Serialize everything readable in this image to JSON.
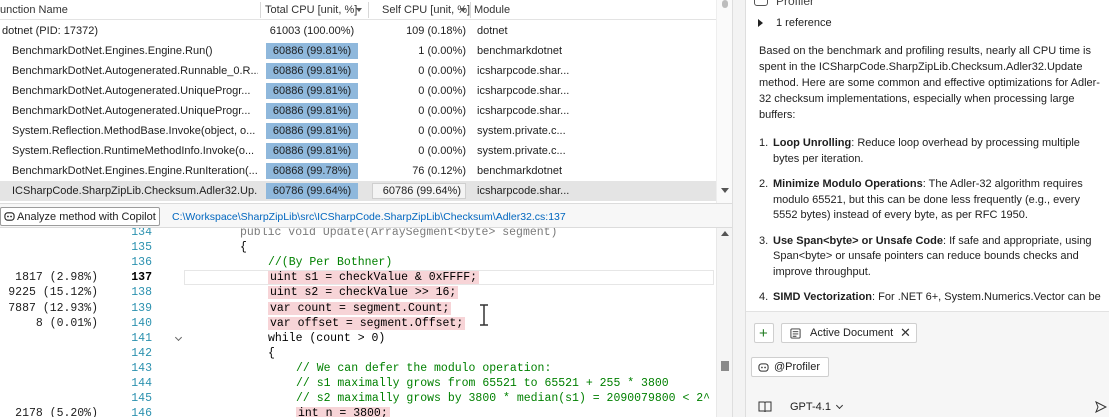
{
  "profiler": {
    "columns": {
      "name": "unction Name",
      "total": "Total CPU [unit, %]",
      "self": "Self CPU [unit, %]",
      "module": "Module"
    },
    "rows": [
      {
        "name": "dotnet (PID: 17372)",
        "total": "61003 (100.00%)",
        "total_fraction": 1.0,
        "self": "109 (0.18%)",
        "module": "dotnet",
        "bar": false
      },
      {
        "name": "BenchmarkDotNet.Engines.Engine.Run()",
        "total": "60886 (99.81%)",
        "total_fraction": 0.9981,
        "self": "1 (0.00%)",
        "module": "benchmarkdotnet",
        "bar": true
      },
      {
        "name": "BenchmarkDotNet.Autogenerated.Runnable_0.R...",
        "total": "60886 (99.81%)",
        "total_fraction": 0.9981,
        "self": "0 (0.00%)",
        "module": "icsharpcode.shar...",
        "bar": true
      },
      {
        "name": "BenchmarkDotNet.Autogenerated.UniqueProgr...",
        "total": "60886 (99.81%)",
        "total_fraction": 0.9981,
        "self": "0 (0.00%)",
        "module": "icsharpcode.shar...",
        "bar": true
      },
      {
        "name": "BenchmarkDotNet.Autogenerated.UniqueProgr...",
        "total": "60886 (99.81%)",
        "total_fraction": 0.9981,
        "self": "0 (0.00%)",
        "module": "icsharpcode.shar...",
        "bar": true
      },
      {
        "name": "System.Reflection.MethodBase.Invoke(object, o...",
        "total": "60886 (99.81%)",
        "total_fraction": 0.9981,
        "self": "0 (0.00%)",
        "module": "system.private.c...",
        "bar": true
      },
      {
        "name": "System.Reflection.RuntimeMethodInfo.Invoke(o...",
        "total": "60886 (99.81%)",
        "total_fraction": 0.9981,
        "self": "0 (0.00%)",
        "module": "system.private.c...",
        "bar": true
      },
      {
        "name": "BenchmarkDotNet.Engines.Engine.RunIteration(...",
        "total": "60868 (99.78%)",
        "total_fraction": 0.9978,
        "self": "76 (0.12%)",
        "module": "benchmarkdotnet",
        "bar": true
      },
      {
        "name": "ICSharpCode.SharpZipLib.Checksum.Adler32.Up...",
        "total": "60786 (99.64%)",
        "total_fraction": 0.9964,
        "self": "60786 (99.64%)",
        "module": "icsharpcode.shar...",
        "bar": true,
        "selected": true
      }
    ]
  },
  "toolbar": {
    "analyze_label": "Analyze method with Copilot",
    "file_path": "C:\\Workspace\\SharpZipLib\\src\\ICSharpCode.SharpZipLib\\Checksum\\Adler32.cs:137"
  },
  "editor": {
    "lines": [
      {
        "hits": "",
        "num": "134",
        "code": "public void Update(ArraySegment<byte> segment)",
        "indent": 0,
        "style": "plain"
      },
      {
        "hits": "",
        "num": "135",
        "code": "{",
        "indent": 1,
        "style": "plain"
      },
      {
        "hits": "",
        "num": "136",
        "code": "//(By Per Bothner)",
        "indent": 2,
        "style": "comment"
      },
      {
        "hits": "1817 (2.98%)",
        "num": "137",
        "code": "uint s1 = checkValue & 0xFFFF;",
        "indent": 2,
        "style": "hl",
        "current": true
      },
      {
        "hits": "9225 (15.12%)",
        "num": "138",
        "code": "uint s2 = checkValue >> 16;",
        "indent": 2,
        "style": "hl"
      },
      {
        "hits": "7887 (12.93%)",
        "num": "139",
        "code": "var count = segment.Count;",
        "indent": 2,
        "style": "hl"
      },
      {
        "hits": "8 (0.01%)",
        "num": "140",
        "code": "var offset = segment.Offset;",
        "indent": 2,
        "style": "hl"
      },
      {
        "hits": "",
        "num": "141",
        "code": "while (count > 0)",
        "indent": 2,
        "style": "plain",
        "fold": true
      },
      {
        "hits": "",
        "num": "142",
        "code": "{",
        "indent": 2,
        "style": "plain"
      },
      {
        "hits": "",
        "num": "143",
        "code": "// We can defer the modulo operation:",
        "indent": 3,
        "style": "comment"
      },
      {
        "hits": "",
        "num": "144",
        "code": "// s1 maximally grows from 65521 to 65521 + 255 * 3800",
        "indent": 3,
        "style": "comment"
      },
      {
        "hits": "",
        "num": "145",
        "code": "// s2 maximally grows by 3800 * median(s1) = 2090079800 < 2^",
        "indent": 3,
        "style": "comment"
      },
      {
        "hits": "2178 (5.20%)",
        "num": "146",
        "code": "int n = 3800;",
        "indent": 3,
        "style": "hl"
      }
    ]
  },
  "chat": {
    "title": "Profiler",
    "reference_label": "1 reference",
    "intro": "Based on the benchmark and profiling results, nearly all CPU time is spent in the ICSharpCode.SharpZipLib.Checksum.Adler32.Update method. Here are some common and effective optimizations for Adler-32 checksum implementations, especially when processing large buffers:",
    "tips": [
      {
        "num": "1.",
        "title": "Loop Unrolling",
        "text": ": Reduce loop overhead by processing multiple bytes per iteration."
      },
      {
        "num": "2.",
        "title": "Minimize Modulo Operations",
        "text": ": The Adler-32 algorithm requires modulo 65521, but this can be done less frequently (e.g., every 5552 bytes) instead of every byte, as per RFC 1950."
      },
      {
        "num": "3.",
        "title": "Use Span<byte> or Unsafe Code",
        "text": ": If safe and appropriate, using Span<byte> or unsafe pointers can reduce bounds checks and improve throughput."
      },
      {
        "num": "4.",
        "title": "SIMD Vectorization",
        "text": ": For .NET 6+, System.Numerics.Vector can be"
      }
    ],
    "plus_label": "+",
    "active_doc_label": "Active Document",
    "close_label": "✕",
    "profiler_chip_label": "@Profiler",
    "model_label": "GPT-4.1"
  },
  "colors": {
    "bar": "#8fb8dc",
    "highlight": "#f7d4d7",
    "link": "#0066bf",
    "comment": "#008000",
    "line_number": "#2b91af"
  }
}
